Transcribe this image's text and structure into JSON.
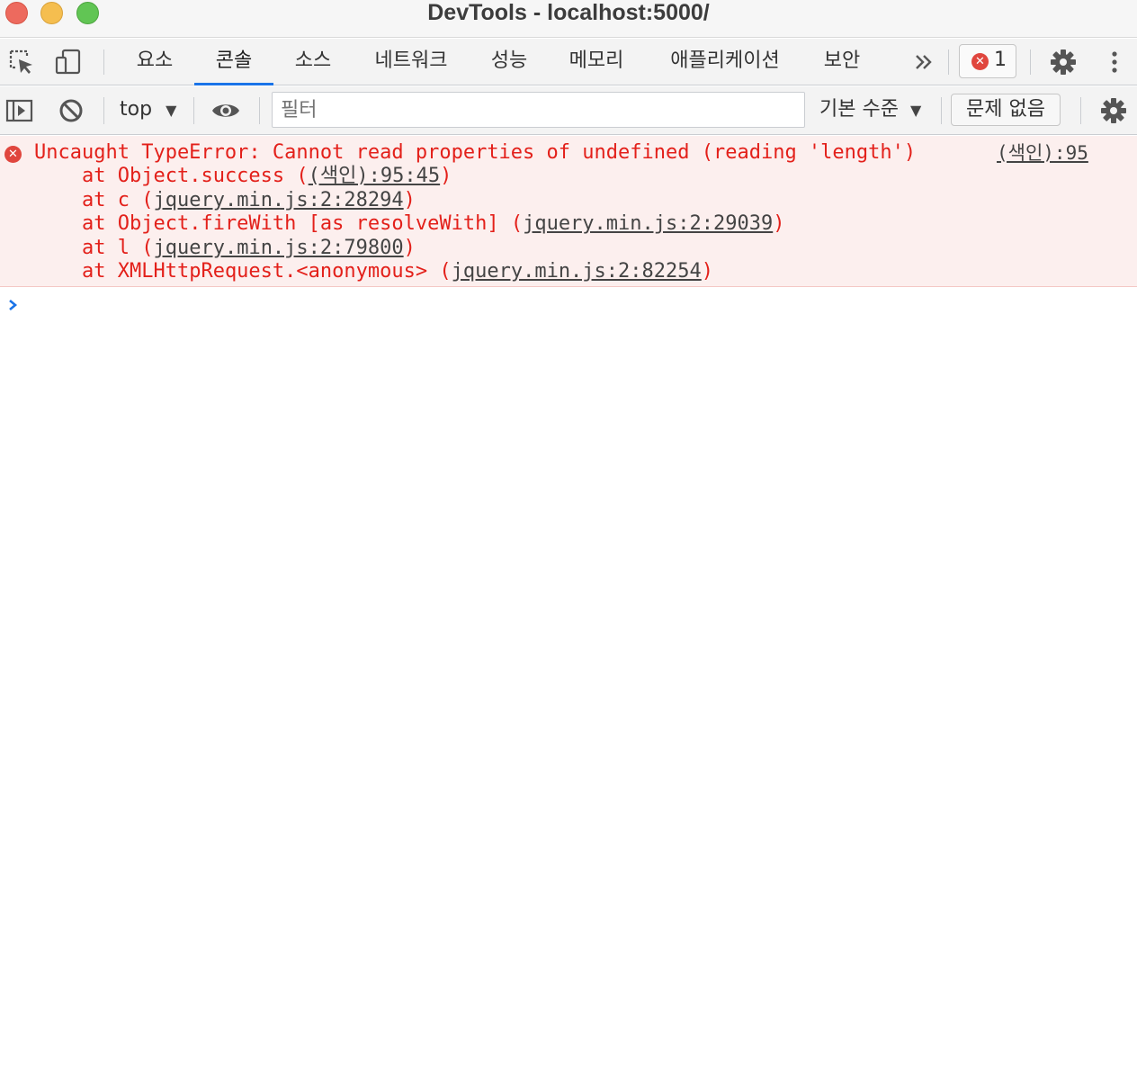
{
  "window": {
    "title": "DevTools - localhost:5000/"
  },
  "tabs": [
    {
      "label": "요소",
      "active": false
    },
    {
      "label": "콘솔",
      "active": true
    },
    {
      "label": "소스",
      "active": false
    },
    {
      "label": "네트워크",
      "active": false
    },
    {
      "label": "성능",
      "active": false
    },
    {
      "label": "메모리",
      "active": false
    },
    {
      "label": "애플리케이션",
      "active": false
    },
    {
      "label": "보안",
      "active": false
    }
  ],
  "tabbar": {
    "more_icon": "double-chevron-right-icon",
    "error_count": "1",
    "settings_icon": "gear-icon",
    "menu_icon": "kebab-menu-icon"
  },
  "console_toolbar": {
    "context": "top",
    "filter_placeholder": "필터",
    "level": "기본 수준",
    "issues": "문제 없음"
  },
  "error": {
    "message": "Uncaught TypeError: Cannot read properties of undefined (reading 'length')",
    "source": "(색인):95",
    "stack": [
      {
        "prefix": "at Object.success (",
        "link": "(색인):95:45",
        "suffix": ")"
      },
      {
        "prefix": "at c (",
        "link": "jquery.min.js:2:28294",
        "suffix": ")"
      },
      {
        "prefix": "at Object.fireWith [as resolveWith] (",
        "link": "jquery.min.js:2:29039",
        "suffix": ")"
      },
      {
        "prefix": "at l (",
        "link": "jquery.min.js:2:79800",
        "suffix": ")"
      },
      {
        "prefix": "at XMLHttpRequest.<anonymous> (",
        "link": "jquery.min.js:2:82254",
        "suffix": ")"
      }
    ]
  },
  "colors": {
    "accent": "#1a73e8",
    "error_text": "#e3201a",
    "error_bg": "#fcefee",
    "error_badge": "#e0463e"
  }
}
